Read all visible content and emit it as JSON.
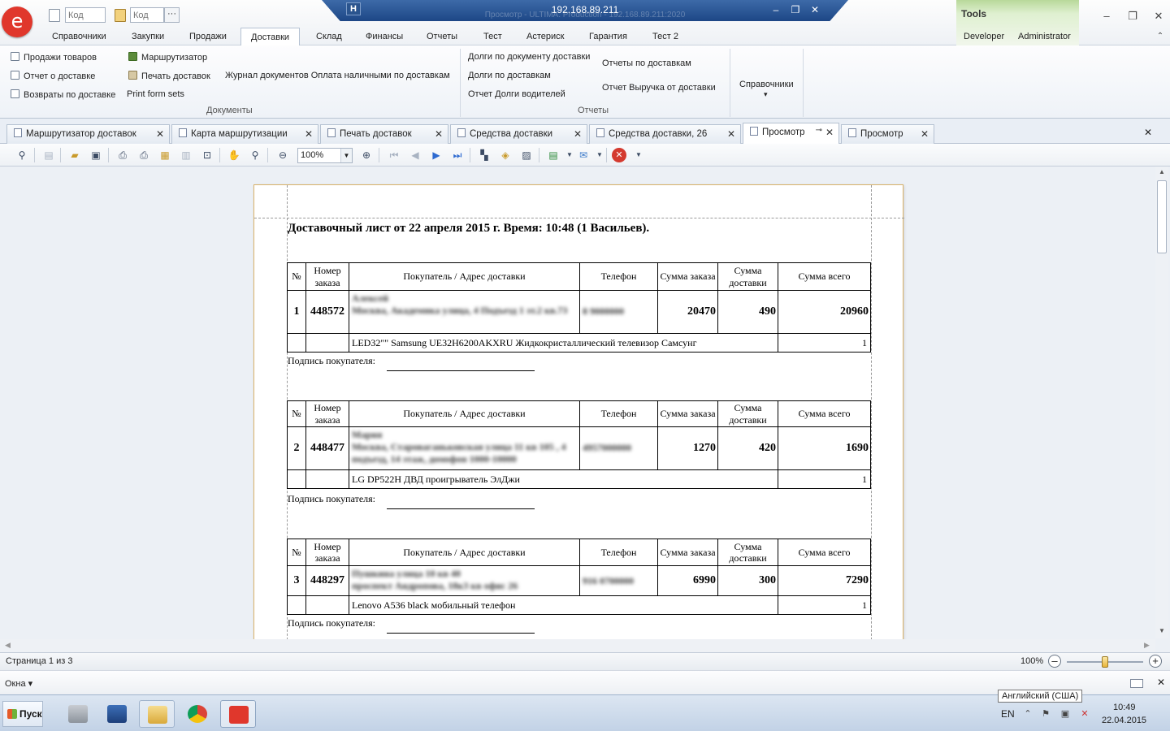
{
  "quick_access": {
    "code_placeholder_1": "Код",
    "code_placeholder_2": "Код",
    "more_label": "···"
  },
  "title_bar": {
    "ip": "192.168.89.211",
    "caption": "Просмотр - ULTIMA. Production - 192.168.89.211:2020"
  },
  "tools": {
    "header": "Tools",
    "developer_tab": "Developer",
    "administrator_tab": "Administrator"
  },
  "ribbon_tabs": [
    "Справочники",
    "Закупки",
    "Продажи",
    "Доставки",
    "Склад",
    "Финансы",
    "Отчеты",
    "Тест",
    "Астериск",
    "Гарантия",
    "Тест 2"
  ],
  "ribbon": {
    "documents": {
      "label": "Документы",
      "sales": "Продажи товаров",
      "delivery_report": "Отчет о доставке",
      "returns": "Возвраты по доставке",
      "router": "Маршрутизатор",
      "print_deliveries": "Печать доставок",
      "print_form_sets": "Print form sets",
      "cash_journal": "Журнал документов Оплата наличными по доставкам"
    },
    "reports": {
      "label": "Отчеты",
      "debts_by_doc": "Долги по документу доставки",
      "debts_by_deliveries": "Долги по доставкам",
      "drivers_debts": "Отчет Долги водителей",
      "delivery_reports": "Отчеты по доставкам",
      "revenue_report": "Отчет Выручка от доставки"
    },
    "references": {
      "label": "Справочники",
      "arrow": "▾"
    }
  },
  "doc_tabs": [
    {
      "label": "Маршрутизатор доставок"
    },
    {
      "label": "Карта маршрутизации"
    },
    {
      "label": "Печать доставок"
    },
    {
      "label": "Средства доставки"
    },
    {
      "label": "Средства доставки, 26"
    },
    {
      "label": "Просмотр"
    },
    {
      "label": "Просмотр"
    }
  ],
  "toolbar": {
    "zoom": "100%"
  },
  "document": {
    "title": "Доставочный лист от 22 апреля 2015 г. Время: 10:48 (1 Васильев).",
    "headers": {
      "num": "№",
      "order": "Номер заказа",
      "buyer": "Покупатель / Адрес доставки",
      "phone": "Телефон",
      "order_sum": "Сумма заказа",
      "delivery_sum": "Сумма доставки",
      "total_sum": "Сумма всего"
    },
    "sign_label": "Подпись покупателя:",
    "orders": [
      {
        "num": "1",
        "order_no": "448572",
        "buyer": "Алексей",
        "address": "Москва, Академика улица, 4 Подъезд 1 эт.2 кв.73",
        "phone": "8 9000000",
        "order_sum": "20470",
        "delivery_sum": "490",
        "total_sum": "20960",
        "item": "LED32\"\" Samsung UE32H6200AKXRU Жидкокристаллический телевизор Самсунг",
        "qty": "1"
      },
      {
        "num": "2",
        "order_no": "448477",
        "buyer": "Мария",
        "address": "Москва, Староваганьковская улица 11 кв 105 , 4 подъезд, 14 этаж, домофон 1000-10000",
        "phone": "4957000000",
        "order_sum": "1270",
        "delivery_sum": "420",
        "total_sum": "1690",
        "item": "LG DP522H ДВД проигрыватель ЭлДжи",
        "qty": "1"
      },
      {
        "num": "3",
        "order_no": "448297",
        "buyer": "Пушкина улица 10 кв 40",
        "address": "проспект Андропова, 18к3 кв офис 26",
        "phone": "916 0700000",
        "order_sum": "6990",
        "delivery_sum": "300",
        "total_sum": "7290",
        "item": "Lenovo A536 black мобильный телефон",
        "qty": "1"
      }
    ]
  },
  "status": {
    "page_counter": "Страница 1 из 3",
    "zoom": "100%"
  },
  "windows_menu": "Окна ▾",
  "taskbar": {
    "start": "Пуск",
    "lang_tooltip": "Английский (США)",
    "lang": "EN",
    "time": "10:49",
    "date": "22.04.2015"
  }
}
